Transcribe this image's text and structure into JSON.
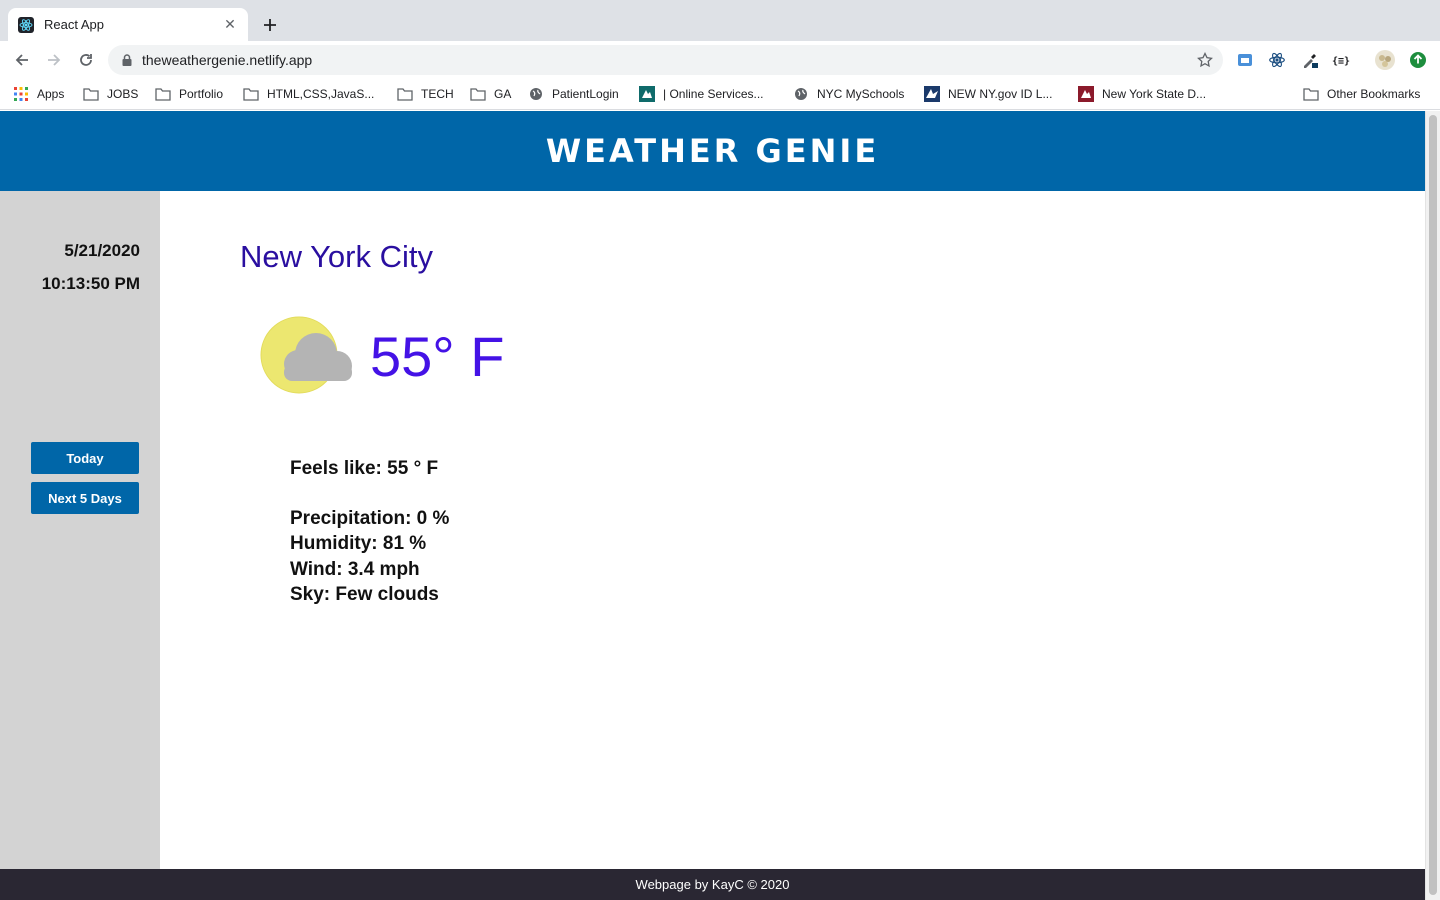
{
  "browser": {
    "tab_title": "React App",
    "url": "theweathergenie.netlify.app",
    "bookmarks": [
      {
        "label": "Apps",
        "icon": "apps-grid-icon"
      },
      {
        "label": "JOBS",
        "icon": "folder-icon"
      },
      {
        "label": "Portfolio",
        "icon": "folder-icon"
      },
      {
        "label": "HTML,CSS,JavaS...",
        "icon": "folder-icon"
      },
      {
        "label": "TECH",
        "icon": "folder-icon"
      },
      {
        "label": "GA",
        "icon": "folder-icon"
      },
      {
        "label": "PatientLogin",
        "icon": "globe-icon"
      },
      {
        "label": "| Online Services...",
        "icon": "nys-icon"
      },
      {
        "label": "NYC MySchools",
        "icon": "globe-icon"
      },
      {
        "label": "NEW NY.gov ID L...",
        "icon": "nygov-icon"
      },
      {
        "label": "New York State D...",
        "icon": "nysd-icon"
      }
    ],
    "other_bookmarks": "Other Bookmarks"
  },
  "app": {
    "title": "WEATHER GENIE",
    "date": "5/21/2020",
    "time": "10:13:50 PM",
    "buttons": {
      "today": "Today",
      "next5": "Next 5 Days"
    },
    "city": "New York City",
    "temperature": "55° F",
    "icon": "partly-cloudy-icon",
    "details": {
      "feels_like": "Feels like: 55 ° F",
      "precipitation": "Precipitation: 0 %",
      "humidity": "Humidity: 81 %",
      "wind": "Wind: 3.4 mph",
      "sky": "Sky: Few clouds"
    },
    "footer": "Webpage by KayC © 2020"
  },
  "colors": {
    "header_bg": "#0066a8",
    "sidebar_bg": "#d3d3d3",
    "city_text": "#2a0fa0",
    "temp_text": "#4412e6",
    "footer_bg": "#2a2733"
  }
}
